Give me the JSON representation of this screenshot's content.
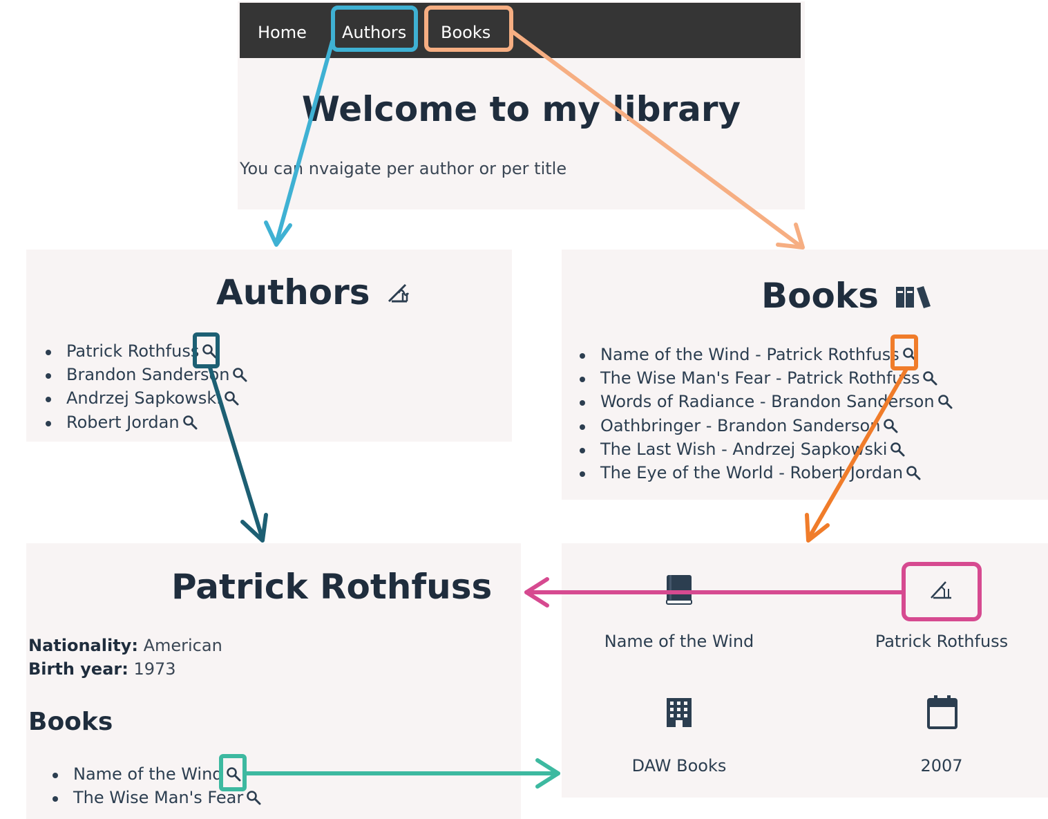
{
  "home": {
    "nav": [
      "Home",
      "Authors",
      "Books"
    ],
    "title": "Welcome to my library",
    "subtitle": "You can nvaigate per author or per title"
  },
  "authors_page": {
    "title": "Authors",
    "icon": "author-signature-icon",
    "items": [
      "Patrick Rothfuss",
      "Brandon Sanderson",
      "Andrzej Sapkowski",
      "Robert Jordan"
    ]
  },
  "books_page": {
    "title": "Books",
    "icon": "books-icon",
    "items": [
      "Name of the Wind - Patrick Rothfuss",
      "The Wise Man's Fear - Patrick Rothfuss",
      "Words of Radiance - Brandon Sanderson",
      "Oathbringer - Brandon Sanderson",
      "The Last Wish - Andrzej Sapkowski",
      "The Eye of the World - Robert Jordan"
    ]
  },
  "author_detail": {
    "name": "Patrick Rothfuss",
    "nationality_label": "Nationality:",
    "nationality": "American",
    "birth_label": "Birth year:",
    "birth_year": "1973",
    "books_heading": "Books",
    "books": [
      "Name of the Wind",
      "The Wise Man's Fear"
    ]
  },
  "book_detail": {
    "title": "Name of the Wind",
    "author": "Patrick Rothfuss",
    "publisher": "DAW Books",
    "year": "2007"
  },
  "colors": {
    "nav_bg": "#353535",
    "panel_bg": "#f8f4f4",
    "text": "#2c3e50",
    "arrow_authors": "#3fb1d3",
    "arrow_books": "#f6ae82",
    "arrow_author_detail": "#1d5f73",
    "arrow_book_detail": "#f07c2a",
    "arrow_author_link": "#d64a90",
    "arrow_book_link": "#3db9a0"
  }
}
